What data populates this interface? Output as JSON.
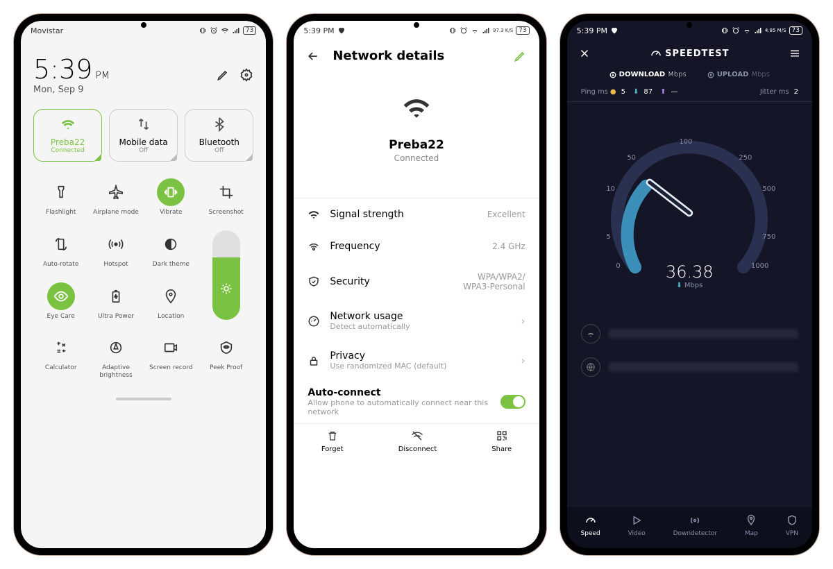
{
  "s1": {
    "carrier": "Movistar",
    "battery": "73",
    "time": "5:39",
    "ampm": "PM",
    "date": "Mon, Sep 9",
    "tiles": [
      {
        "label": "Preba22",
        "sub": "Connected"
      },
      {
        "label": "Mobile data",
        "sub": "Off"
      },
      {
        "label": "Bluetooth",
        "sub": "Off"
      }
    ],
    "grid": [
      {
        "label": "Flashlight"
      },
      {
        "label": "Airplane mode"
      },
      {
        "label": "Vibrate"
      },
      {
        "label": "Screenshot"
      },
      {
        "label": "Auto-rotate"
      },
      {
        "label": "Hotspot"
      },
      {
        "label": "Dark theme"
      },
      {
        "label": "Eye Care"
      },
      {
        "label": "Ultra Power"
      },
      {
        "label": "Location"
      },
      {
        "label": "Calculator"
      },
      {
        "label": "Adaptive brightness"
      },
      {
        "label": "Screen record"
      },
      {
        "label": "Peek Proof"
      }
    ]
  },
  "s2": {
    "time": "5:39 PM",
    "kbs": "97.3 K/S",
    "battery": "73",
    "title": "Network details",
    "ssid": "Preba22",
    "status": "Connected",
    "rows": [
      {
        "label": "Signal strength",
        "val": "Excellent"
      },
      {
        "label": "Frequency",
        "val": "2.4 GHz"
      },
      {
        "label": "Security",
        "val": "WPA/WPA2/ WPA3-Personal"
      },
      {
        "label": "Network usage",
        "sub": "Detect automatically",
        "chev": "›"
      },
      {
        "label": "Privacy",
        "sub": "Use randomized MAC (default)",
        "chev": "›"
      }
    ],
    "auto": {
      "title": "Auto-connect",
      "sub": "Allow phone to automatically connect near this network"
    },
    "bottom": [
      {
        "label": "Forget"
      },
      {
        "label": "Disconnect"
      },
      {
        "label": "Share"
      }
    ]
  },
  "s3": {
    "time": "5:39 PM",
    "mbs": "4.85 M/S",
    "battery": "73",
    "brand": "SPEEDTEST",
    "tabs": [
      {
        "label": "DOWNLOAD",
        "unit": "Mbps"
      },
      {
        "label": "UPLOAD",
        "unit": "Mbps"
      }
    ],
    "ping": {
      "label": "Ping",
      "unit": "ms",
      "idle": "5",
      "down": "87",
      "up": "—"
    },
    "jitter": {
      "label": "Jitter",
      "unit": "ms",
      "val": "2"
    },
    "gauge": {
      "value": "36.38",
      "unit": "Mbps",
      "scale": [
        "0",
        "5",
        "10",
        "50",
        "100",
        "250",
        "500",
        "750",
        "1000"
      ]
    },
    "nav": [
      {
        "label": "Speed"
      },
      {
        "label": "Video"
      },
      {
        "label": "Downdetector"
      },
      {
        "label": "Map"
      },
      {
        "label": "VPN"
      }
    ]
  }
}
